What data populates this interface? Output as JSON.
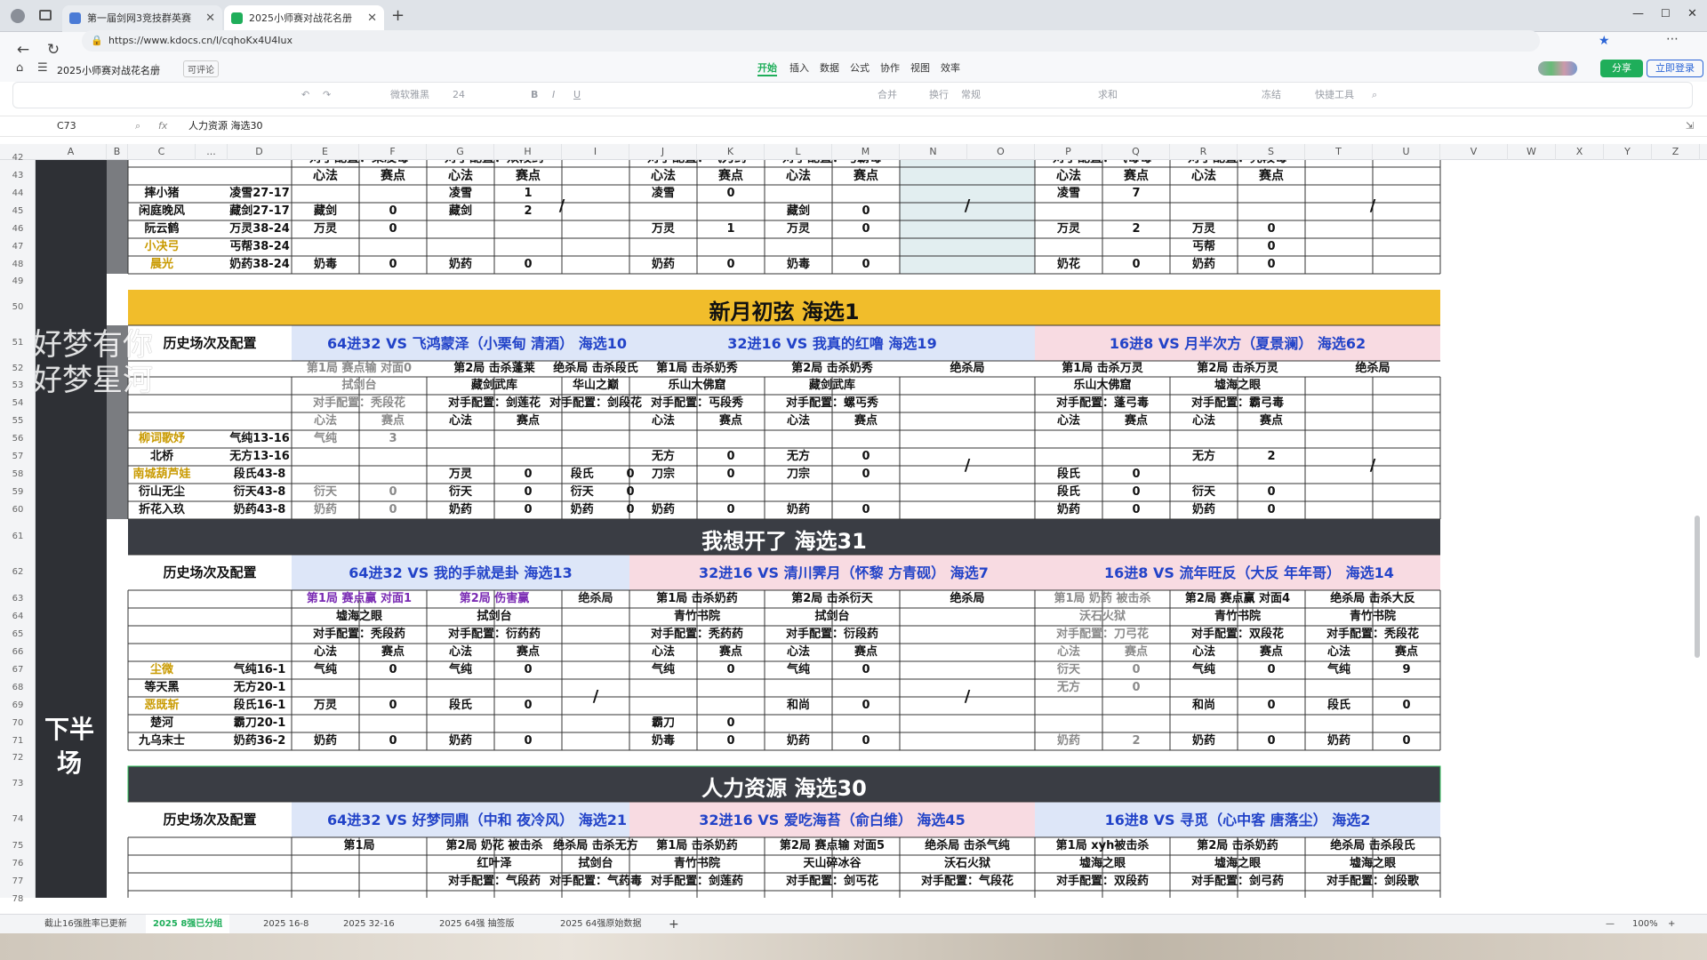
{
  "browser": {
    "tabs": [
      {
        "label": "第一届剑网3竞技群英赛",
        "color": "#4a7bd6"
      },
      {
        "label": "2025小师赛对战花名册",
        "color": "#1fae5a"
      }
    ],
    "url": "https://www.kdocs.cn/l/cqhoKx4U4Iux"
  },
  "app": {
    "doc_title": "2025小师赛对战花名册",
    "edit_badge": "可评论",
    "menus": [
      "开始",
      "插入",
      "数据",
      "公式",
      "协作",
      "视图",
      "效率"
    ],
    "active_menu": "开始",
    "share_label": "分享",
    "login_label": "立即登录",
    "accent": "#1fae5a"
  },
  "ribbon": {
    "items": [
      "微软雅黑",
      "24",
      "合并",
      "换行",
      "常规",
      "求和",
      "冻结",
      "快捷工具"
    ]
  },
  "formula": {
    "cell_ref": "C73",
    "fx": "fx",
    "content": "人力资源 海选30"
  },
  "columns": [
    "A",
    "B",
    "C",
    "...",
    "D",
    "E",
    "F",
    "G",
    "H",
    "I",
    "J",
    "K",
    "L",
    "M",
    "N",
    "O",
    "P",
    "Q",
    "R",
    "S",
    "T",
    "U",
    "V",
    "W",
    "X",
    "Y",
    "Z"
  ],
  "rows": [
    "42",
    "43",
    "44",
    "45",
    "46",
    "47",
    "48",
    "49",
    "50",
    "51",
    "52",
    "53",
    "54",
    "55",
    "56",
    "57",
    "58",
    "59",
    "60",
    "61",
    "62",
    "63",
    "64",
    "65",
    "66",
    "67",
    "68",
    "69",
    "70",
    "71",
    "72",
    "73",
    "74",
    "75",
    "76",
    "77",
    "78"
  ],
  "side": {
    "label": "下半场",
    "overlay1": "好梦有你",
    "overlay2": "好梦星河"
  },
  "common": {
    "slash": "/",
    "xinfa": "心法",
    "saidian": "赛点",
    "history": "历史场次及配置",
    "juesha": "绝杀局"
  },
  "top": {
    "opp": [
      "对手配置：策凌毒",
      "对手配置：双段药",
      "对手配置：气刀药",
      "对手配置：丐霸毒",
      "对手配置：气毒毒",
      "对手配置：秃段毒"
    ],
    "players": [
      {
        "name": "摔小猪",
        "conf": "凌雪27-17",
        "gold": false
      },
      {
        "name": "闲庭晚风",
        "conf": "藏剑27-17",
        "gold": false
      },
      {
        "name": "阮云鹤",
        "conf": "万灵38-24",
        "gold": false
      },
      {
        "name": "小决弓",
        "conf": "丐帮38-24",
        "gold": true
      },
      {
        "name": "晨光",
        "conf": "奶药38-24",
        "gold": true
      }
    ],
    "cells": [
      [
        "",
        "",
        "凌雪",
        "1",
        "凌雪",
        "0",
        "",
        "",
        "凌雪",
        "7",
        "",
        ""
      ],
      [
        "藏剑",
        "0",
        "藏剑",
        "2",
        "",
        "",
        "藏剑",
        "0",
        "",
        "",
        "",
        ""
      ],
      [
        "万灵",
        "0",
        "",
        "",
        "万灵",
        "1",
        "万灵",
        "0",
        "万灵",
        "2",
        "万灵",
        "0"
      ],
      [
        "",
        "",
        "",
        "",
        "",
        "",
        "",
        "",
        "",
        "",
        "丐帮",
        "0"
      ],
      [
        "奶毒",
        "0",
        "奶药",
        "0",
        "奶药",
        "0",
        "奶毒",
        "0",
        "奶花",
        "0",
        "奶药",
        "0"
      ]
    ]
  },
  "b1": {
    "title": "新月初弦 海选1",
    "color": "#f1bd2b",
    "matches": [
      "64进32 VS 飞鸿蒙泽（小栗甸 清酒） 海选10",
      "32进16 VS 我真的红噜 海选19",
      "16进8 VS 月半次方（夏景澜） 海选62"
    ],
    "match_colors": [
      "#dde6f8",
      "#dde6f8",
      "#f8dbe2"
    ],
    "rounds": [
      "第1局 赛点输 对面0",
      "第2局 击杀蓬莱",
      "绝杀局 击杀段氏",
      "第1局 击杀奶秀",
      "第2局 击杀奶秀",
      "绝杀局",
      "第1局 击杀万灵",
      "第2局 击杀万灵",
      "绝杀局"
    ],
    "maps": [
      "拭剑台",
      "藏剑武库",
      "华山之巅",
      "乐山大佛窟",
      "藏剑武库",
      "",
      "乐山大佛窟",
      "墟海之眼",
      ""
    ],
    "opps": [
      "对手配置：秃段花",
      "对手配置：剑莲花",
      "对手配置：剑段花",
      "对手配置：丐段秀",
      "对手配置：螺丐秀",
      "",
      "对手配置：蓬弓毒",
      "对手配置：霸弓毒",
      ""
    ],
    "players": [
      {
        "name": "柳词歌妤",
        "conf": "气纯13-16",
        "gold": true
      },
      {
        "name": "北桥",
        "conf": "无方13-16",
        "gold": false
      },
      {
        "name": "南城葫芦娃",
        "conf": "段氏43-8",
        "gold": true
      },
      {
        "name": "衍山无尘",
        "conf": "衍天43-8",
        "gold": false
      },
      {
        "name": "折花入玖",
        "conf": "奶药43-8",
        "gold": false
      }
    ],
    "cells": [
      [
        "气纯",
        "3",
        "",
        "",
        "",
        "",
        "",
        "",
        "",
        "",
        "",
        "",
        "",
        ""
      ],
      [
        "",
        "",
        "",
        "",
        "",
        "",
        "无方",
        "0",
        "无方",
        "0",
        "",
        "",
        "无方",
        "2"
      ],
      [
        "",
        "",
        "万灵",
        "0",
        "段氏",
        "0",
        "刀宗",
        "0",
        "刀宗",
        "0",
        "段氏",
        "0",
        "",
        ""
      ],
      [
        "衍天",
        "0",
        "衍天",
        "0",
        "衍天",
        "0",
        "",
        "",
        "",
        "",
        "段氏",
        "0",
        "衍天",
        "0"
      ],
      [
        "奶药",
        "0",
        "奶药",
        "0",
        "奶药",
        "0",
        "奶药",
        "0",
        "奶药",
        "0",
        "奶药",
        "0",
        "奶药",
        "0"
      ]
    ]
  },
  "b2": {
    "title": "我想开了 海选31",
    "color": "#3a3d44",
    "matches": [
      "64进32 VS 我的手就是卦 海选13",
      "32进16 VS 清川霁月（怀黎 方青砚） 海选7",
      "16进8 VS 流年旺反（大反 年年哥） 海选14"
    ],
    "match_colors": [
      "#dde6f8",
      "#f8dbe2",
      "#f8dbe2"
    ],
    "rounds": [
      "第1局 赛点赢 对面1",
      "第2局 伤害赢",
      "绝杀局",
      "第1局 击杀奶药",
      "第2局 击杀衍天",
      "绝杀局",
      "第1局 奶药 被击杀",
      "第2局 赛点赢 对面4",
      "绝杀局 击杀大反"
    ],
    "maps": [
      "墟海之眼",
      "拭剑台",
      "",
      "青竹书院",
      "拭剑台",
      "",
      "沃石火狱",
      "青竹书院",
      "青竹书院"
    ],
    "opps": [
      "对手配置：秃段药",
      "对手配置：衍药药",
      "",
      "对手配置：秃药药",
      "对手配置：衍段药",
      "",
      "对手配置：刀弓花",
      "对手配置：双段花",
      "对手配置：秃段花"
    ],
    "players": [
      {
        "name": "尘微",
        "conf": "气纯16-1",
        "gold": true
      },
      {
        "name": "等天黑",
        "conf": "无方20-1",
        "gold": false
      },
      {
        "name": "恶既斩",
        "conf": "段氏16-1",
        "gold": true
      },
      {
        "name": "楚河",
        "conf": "霸刀20-1",
        "gold": false
      },
      {
        "name": "九乌末士",
        "conf": "奶药36-2",
        "gold": false
      }
    ],
    "cells": [
      [
        "气纯",
        "0",
        "气纯",
        "0",
        "气纯",
        "0",
        "气纯",
        "0",
        "衍天",
        "0",
        "气纯",
        "0",
        "气纯",
        "9"
      ],
      [
        "",
        "",
        "",
        "",
        "",
        "",
        "",
        "",
        "无方",
        "0",
        "",
        "",
        "",
        ""
      ],
      [
        "万灵",
        "0",
        "段氏",
        "0",
        "",
        "",
        "和尚",
        "0",
        "",
        "",
        "和尚",
        "0",
        "段氏",
        "0"
      ],
      [
        "",
        "",
        "",
        "",
        "霸刀",
        "0",
        "",
        "",
        "",
        "",
        "",
        "",
        "",
        ""
      ],
      [
        "奶药",
        "0",
        "奶药",
        "0",
        "奶毒",
        "0",
        "奶药",
        "0",
        "奶药",
        "2",
        "奶药",
        "0",
        "奶药",
        "0"
      ]
    ]
  },
  "b3": {
    "title": "人力资源 海选30",
    "color": "#3a3d44",
    "matches": [
      "64进32 VS 好梦同鼎（中和 夜冷风） 海选21",
      "32进16 VS 爱吃海苔（俞白维） 海选45",
      "16进8 VS 寻觅（心中客 唐落尘） 海选2"
    ],
    "match_colors": [
      "#dde6f8",
      "#f8dbe2",
      "#dde6f8"
    ],
    "rounds": [
      "第1局",
      "第2局 奶花 被击杀",
      "绝杀局 击杀无方",
      "第1局 击杀奶药",
      "第2局 赛点输 对面5",
      "绝杀局 击杀气纯",
      "第1局 xyh被击杀",
      "第2局 击杀奶药",
      "绝杀局 击杀段氏"
    ],
    "maps": [
      "",
      "红叶泽",
      "拭剑台",
      "青竹书院",
      "天山碎冰谷",
      "沃石火狱",
      "墟海之眼",
      "墟海之眼",
      "墟海之眼"
    ],
    "opps": [
      "",
      "对手配置：气段药",
      "对手配置：气药毒",
      "对手配置：剑莲药",
      "对手配置：剑丐花",
      "对手配置：气段花",
      "对手配置：双段药",
      "对手配置：剑弓药",
      "对手配置：剑段歌"
    ]
  },
  "sheets": [
    "截止16强胜率已更新",
    "2025 8强已分组",
    "2025 16-8",
    "2025 32-16",
    "2025 64强 抽签版",
    "2025 64强原始数据"
  ],
  "active_sheet": "2025 8强已分组",
  "zoom": "100%"
}
